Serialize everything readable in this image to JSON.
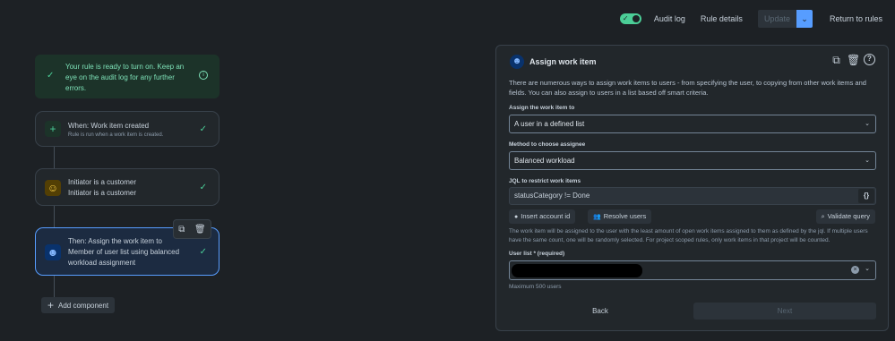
{
  "topbar": {
    "audit_log": "Audit log",
    "rule_details": "Rule details",
    "update": "Update",
    "return": "Return to rules"
  },
  "banner": {
    "text": "Your rule is ready to turn on. Keep an eye on the audit log for any further errors."
  },
  "flow": {
    "trigger": {
      "title": "When: Work item created",
      "subtitle": "Rule is run when a work item is created."
    },
    "condition": {
      "line1": "Initiator is a customer",
      "line2": "Initiator is a customer"
    },
    "action": {
      "line1": "Then: Assign the work item to",
      "line2": "Member of user list using balanced",
      "line3": "workload assignment"
    },
    "add_component": "Add component"
  },
  "panel": {
    "title": "Assign work item",
    "description": "There are numerous ways to assign work items to users - from specifying the user, to copying from other work items and fields. You can also assign to users in a list based off smart criteria.",
    "assign_label": "Assign the work item to",
    "assign_value": "A user in a defined list",
    "method_label": "Method to choose assignee",
    "method_value": "Balanced workload",
    "jql_label": "JQL to restrict work items",
    "jql_value": "statusCategory != Done",
    "jql_icon": "{}",
    "insert_account": "Insert account id",
    "resolve_users": "Resolve users",
    "validate_query": "Validate query",
    "note": "The work item will be assigned to the user with the least amount of open work items assigned to them as defined by the jql. If multiple users have the same count, one will be randomly selected. For project scoped rules, only work items in that project will be counted.",
    "userlist_label": "User list * (required)",
    "max_users": "Maximum 500 users",
    "back": "Back",
    "next": "Next"
  },
  "colors": {
    "background": "#1d2125",
    "accent": "#579dff",
    "success": "#4bce97"
  }
}
